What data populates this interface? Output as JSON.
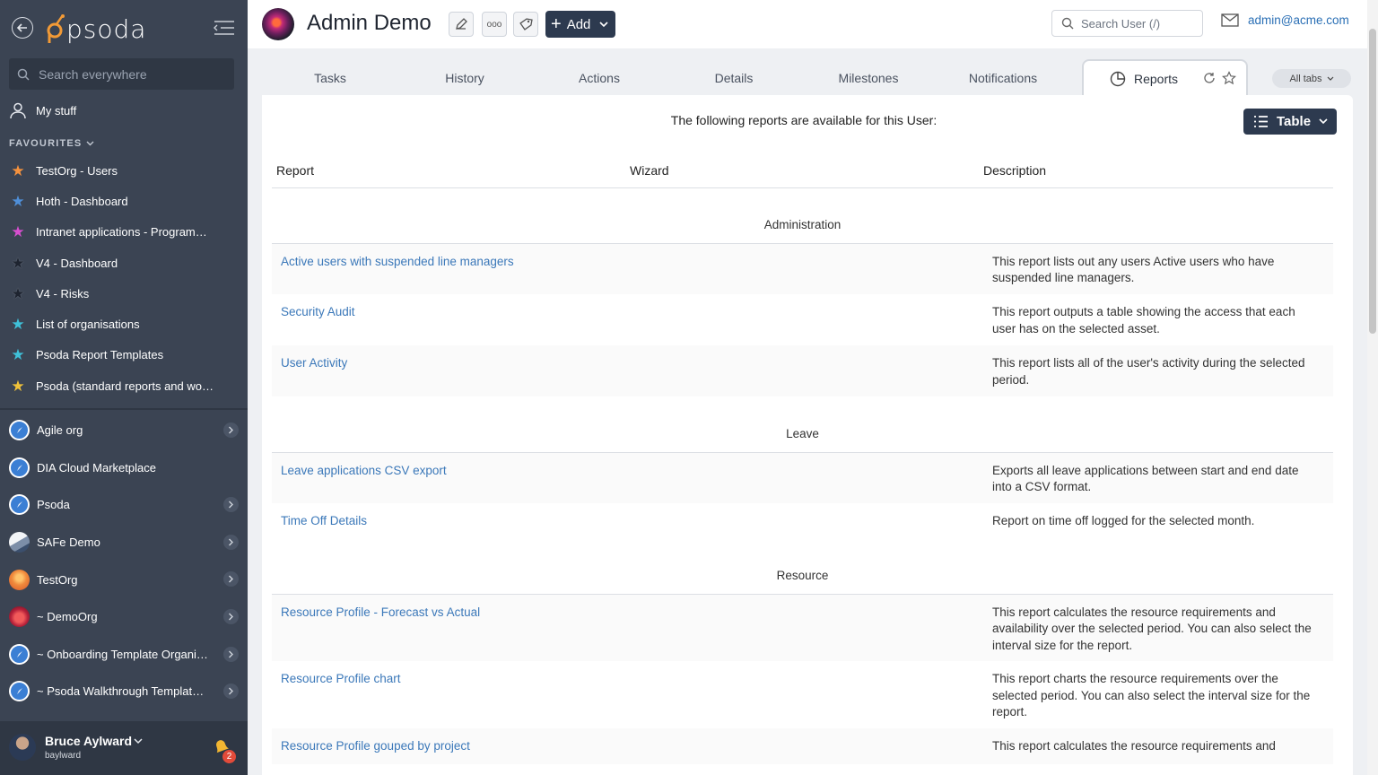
{
  "sidebar": {
    "logo_text": "psoda",
    "search_placeholder": "Search everywhere",
    "my_stuff": "My stuff",
    "favourites_label": "FAVOURITES",
    "favourites": [
      {
        "label": "TestOrg - Users",
        "color": "#f5923e"
      },
      {
        "label": "Hoth - Dashboard",
        "color": "#4f8fd8"
      },
      {
        "label": "Intranet applications - Programme...",
        "color": "#d74fcf"
      },
      {
        "label": "V4 - Dashboard",
        "color": "#1e2430"
      },
      {
        "label": "V4 - Risks",
        "color": "#1e2430"
      },
      {
        "label": "List of organisations",
        "color": "#3fc1d9"
      },
      {
        "label": "Psoda Report Templates",
        "color": "#3fc1d9"
      },
      {
        "label": "Psoda (standard reports and work...",
        "color": "#f0c23a"
      }
    ],
    "organisations": [
      {
        "label": "Agile org",
        "icon": "compass",
        "arrow": true
      },
      {
        "label": "DIA Cloud Marketplace",
        "icon": "compass",
        "arrow": false
      },
      {
        "label": "Psoda",
        "icon": "compass",
        "arrow": true
      },
      {
        "label": "SAFe Demo",
        "icon": "mountain",
        "arrow": true
      },
      {
        "label": "TestOrg",
        "icon": "sunset",
        "arrow": true
      },
      {
        "label": "~ DemoOrg",
        "icon": "red-circle",
        "arrow": true
      },
      {
        "label": "~ Onboarding Template Organisa...",
        "icon": "compass",
        "arrow": true
      },
      {
        "label": "~ Psoda Walkthrough Template P...",
        "icon": "compass",
        "arrow": true
      }
    ],
    "user": {
      "name": "Bruce Aylward",
      "handle": "baylward",
      "notifications": "2"
    }
  },
  "header": {
    "title": "Admin Demo",
    "more_label": "ooo",
    "add_label": "Add",
    "search_placeholder": "Search User (/)",
    "email": "admin@acme.com"
  },
  "tabs": [
    "Tasks",
    "History",
    "Actions",
    "Details",
    "Milestones",
    "Notifications",
    "Reports"
  ],
  "active_tab": "Reports",
  "all_tabs_label": "All tabs",
  "content": {
    "intro": "The following reports are available for this User:",
    "view_label": "Table",
    "columns": [
      "Report",
      "Wizard",
      "Description"
    ],
    "groups": [
      {
        "name": "Administration",
        "rows": [
          {
            "report": "Active users with suspended line managers",
            "wizard": "",
            "description": "This report lists out any users Active users who have suspended line managers."
          },
          {
            "report": "Security Audit",
            "wizard": "",
            "description": "This report outputs a table showing the access that each user has on the selected asset."
          },
          {
            "report": "User Activity",
            "wizard": "",
            "description": "This report lists all of the user's activity during the selected period."
          }
        ]
      },
      {
        "name": "Leave",
        "rows": [
          {
            "report": "Leave applications CSV export",
            "wizard": "",
            "description": "Exports all leave applications between start and end date into a CSV format."
          },
          {
            "report": "Time Off Details",
            "wizard": "",
            "description": "Report on time off logged for the selected month."
          }
        ]
      },
      {
        "name": "Resource",
        "rows": [
          {
            "report": "Resource Profile - Forecast vs Actual",
            "wizard": "",
            "description": "This report calculates the resource requirements and availability over the selected period. You can also select the interval size for the report."
          },
          {
            "report": "Resource Profile chart",
            "wizard": "",
            "description": "This report charts the resource requirements over the selected period. You can also select the interval size for the report."
          },
          {
            "report": "Resource Profile gouped by project",
            "wizard": "",
            "description": "This report calculates the resource requirements and"
          }
        ]
      }
    ]
  }
}
